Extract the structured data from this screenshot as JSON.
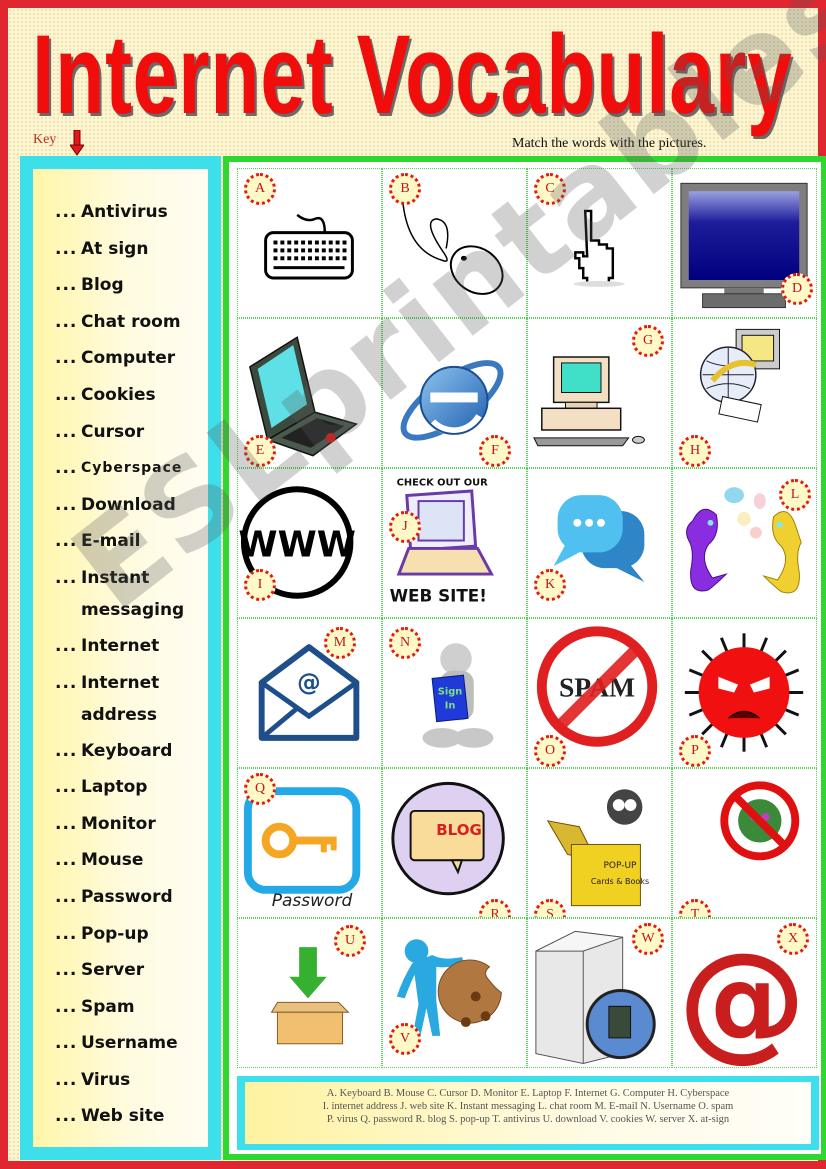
{
  "title": "Internet Vocabulary",
  "key_label": "Key",
  "instructions": "Match the words with the pictures.",
  "watermark": "ESLprintables.com",
  "colors": {
    "page_border": "#e0262e",
    "title": "#f20d0d",
    "word_panel_border": "#3de0ea",
    "picture_panel_border": "#2ed82e",
    "badge_border": "#e01818"
  },
  "word_list": [
    {
      "dots": "...",
      "term": "Antivirus"
    },
    {
      "dots": "...",
      "term": "At sign"
    },
    {
      "dots": "...",
      "term": "Blog"
    },
    {
      "dots": "...",
      "term": "Chat room"
    },
    {
      "dots": "...",
      "term": "Computer"
    },
    {
      "dots": "...",
      "term": "Cookies"
    },
    {
      "dots": "...",
      "term": "Cursor"
    },
    {
      "dots": "...",
      "term": "Cyberspace"
    },
    {
      "dots": "...",
      "term": "Download"
    },
    {
      "dots": "...",
      "term": "E-mail"
    },
    {
      "dots": "...",
      "term": "Instant messaging"
    },
    {
      "dots": "...",
      "term": "Internet"
    },
    {
      "dots": "...",
      "term": "Internet address"
    },
    {
      "dots": "...",
      "term": "Keyboard"
    },
    {
      "dots": "...",
      "term": "Laptop"
    },
    {
      "dots": "...",
      "term": "Monitor"
    },
    {
      "dots": "...",
      "term": "Mouse"
    },
    {
      "dots": "...",
      "term": "Password"
    },
    {
      "dots": "...",
      "term": "Pop-up"
    },
    {
      "dots": "...",
      "term": "Server"
    },
    {
      "dots": "...",
      "term": "Spam"
    },
    {
      "dots": "...",
      "term": "Username"
    },
    {
      "dots": "...",
      "term": "Virus"
    },
    {
      "dots": "...",
      "term": "Web site"
    }
  ],
  "pictures": [
    {
      "letter": "A",
      "icon": "keyboard-icon"
    },
    {
      "letter": "B",
      "icon": "mouse-icon"
    },
    {
      "letter": "C",
      "icon": "hand-cursor-icon"
    },
    {
      "letter": "D",
      "icon": "monitor-icon"
    },
    {
      "letter": "E",
      "icon": "laptop-icon"
    },
    {
      "letter": "F",
      "icon": "internet-explorer-icon"
    },
    {
      "letter": "G",
      "icon": "desktop-computer-icon"
    },
    {
      "letter": "H",
      "icon": "cyberspace-globe-icon"
    },
    {
      "letter": "I",
      "icon": "www-icon",
      "text": "WWW"
    },
    {
      "letter": "J",
      "icon": "website-laptop-icon",
      "text_top": "CHECK OUT OUR",
      "text_bottom": "WEB SITE!"
    },
    {
      "letter": "K",
      "icon": "chat-bubbles-icon"
    },
    {
      "letter": "L",
      "icon": "chatting-aliens-icon"
    },
    {
      "letter": "M",
      "icon": "email-envelope-icon",
      "text": "@"
    },
    {
      "letter": "N",
      "icon": "sign-in-figure-icon",
      "text": "Sign In"
    },
    {
      "letter": "O",
      "icon": "no-spam-icon",
      "text": "SPAM"
    },
    {
      "letter": "P",
      "icon": "virus-icon"
    },
    {
      "letter": "Q",
      "icon": "password-key-icon",
      "text": "Password"
    },
    {
      "letter": "R",
      "icon": "blog-bubble-icon",
      "text": "BLOG"
    },
    {
      "letter": "S",
      "icon": "popup-box-icon",
      "text_top": "POP-UP",
      "text_bottom": "Cards & Books"
    },
    {
      "letter": "T",
      "icon": "antivirus-icon"
    },
    {
      "letter": "U",
      "icon": "download-box-icon"
    },
    {
      "letter": "V",
      "icon": "cookie-icon"
    },
    {
      "letter": "W",
      "icon": "server-icon"
    },
    {
      "letter": "X",
      "icon": "at-sign-icon",
      "text": "@"
    }
  ],
  "answer_key": {
    "line1": "A. Keyboard  B. Mouse   C. Cursor   D. Monitor   E. Laptop   F. Internet   G. Computer   H. Cyberspace",
    "line2": "I. internet address   J. web site   K. Instant messaging   L. chat room   M. E-mail   N. Username   O. spam",
    "line3": "P. virus   Q. password   R. blog   S. pop-up   T. antivirus   U. download   V. cookies   W. server   X. at-sign"
  }
}
